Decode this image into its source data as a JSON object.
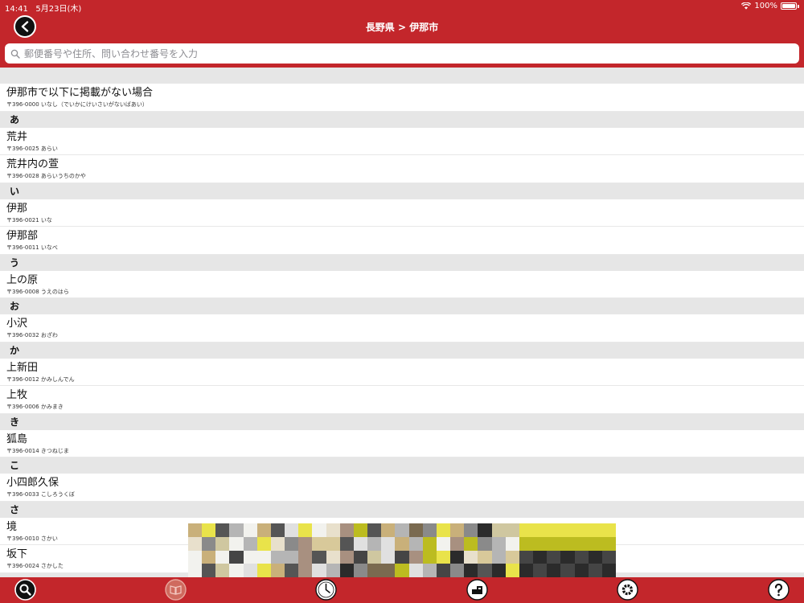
{
  "status_bar": {
    "time": "14:41",
    "date": "5月23日(木)",
    "battery": "100%"
  },
  "header": {
    "title": "長野県 > 伊那市"
  },
  "search": {
    "placeholder": "郵便番号や住所、問い合わせ番号を入力",
    "value": ""
  },
  "colors": {
    "brand_red": "#c3262b",
    "section_bg": "#e6e6e6"
  },
  "list": [
    {
      "type": "spacer"
    },
    {
      "type": "row",
      "name": "伊那市で以下に掲載がない場合",
      "sub": "〒396-0000 いなし（でいかにけいさいがないばあい）"
    },
    {
      "type": "section",
      "label": "あ"
    },
    {
      "type": "row",
      "name": "荒井",
      "sub": "〒396-0025 あらい"
    },
    {
      "type": "row",
      "name": "荒井内の萱",
      "sub": "〒396-0028 あらいうちのかや"
    },
    {
      "type": "section",
      "label": "い"
    },
    {
      "type": "row",
      "name": "伊那",
      "sub": "〒396-0021 いな"
    },
    {
      "type": "row",
      "name": "伊那部",
      "sub": "〒396-0011 いなべ"
    },
    {
      "type": "section",
      "label": "う"
    },
    {
      "type": "row",
      "name": "上の原",
      "sub": "〒396-0008 うえのはら"
    },
    {
      "type": "section",
      "label": "お"
    },
    {
      "type": "row",
      "name": "小沢",
      "sub": "〒396-0032 おざわ"
    },
    {
      "type": "section",
      "label": "か"
    },
    {
      "type": "row",
      "name": "上新田",
      "sub": "〒396-0012 かみしんでん"
    },
    {
      "type": "row",
      "name": "上牧",
      "sub": "〒396-0006 かみまき"
    },
    {
      "type": "section",
      "label": "き"
    },
    {
      "type": "row",
      "name": "狐島",
      "sub": "〒396-0014 きつねじま"
    },
    {
      "type": "section",
      "label": "こ"
    },
    {
      "type": "row",
      "name": "小四郎久保",
      "sub": "〒396-0033 こしろうくぼ"
    },
    {
      "type": "section",
      "label": "さ"
    },
    {
      "type": "row",
      "name": "境",
      "sub": "〒396-0010 さかい"
    },
    {
      "type": "row",
      "name": "坂下",
      "sub": "〒396-0024 さかした"
    },
    {
      "type": "section",
      "label": ""
    }
  ],
  "tabbar": [
    {
      "icon": "search-icon",
      "active": true
    },
    {
      "icon": "book-icon",
      "active": false
    },
    {
      "icon": "clock-icon",
      "active": false
    },
    {
      "icon": "package-icon",
      "active": false
    },
    {
      "icon": "gear-icon",
      "active": false
    },
    {
      "icon": "help-icon",
      "active": false
    }
  ]
}
